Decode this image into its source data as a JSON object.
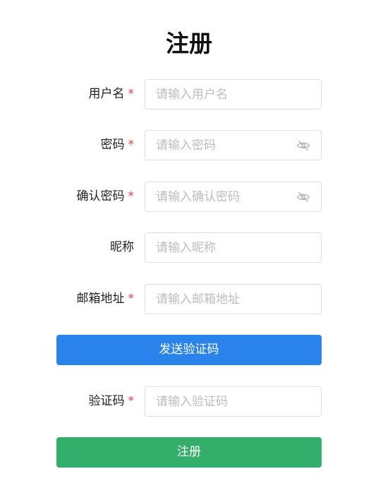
{
  "title": "注册",
  "required_mark": "*",
  "fields": [
    {
      "label": "用户名",
      "placeholder": "请输入用户名",
      "required": true,
      "icon": null
    },
    {
      "label": "密码",
      "placeholder": "请输入密码",
      "required": true,
      "icon": "eye-off-icon"
    },
    {
      "label": "确认密码",
      "placeholder": "请输入确认密码",
      "required": true,
      "icon": "eye-off-icon"
    },
    {
      "label": "昵称",
      "placeholder": "请输入昵称",
      "required": false,
      "icon": null
    },
    {
      "label": "邮箱地址",
      "placeholder": "请输入邮箱地址",
      "required": true,
      "icon": null
    },
    {
      "label": "验证码",
      "placeholder": "请输入验证码",
      "required": true,
      "icon": null
    }
  ],
  "buttons": {
    "send_code": "发送验证码",
    "register": "注册"
  },
  "colors": {
    "required": "#e0424d",
    "send_code_button": "#2a83ea",
    "register_button": "#34ae6b",
    "input_border": "#dcdfe6",
    "placeholder": "#bdbdbd"
  }
}
